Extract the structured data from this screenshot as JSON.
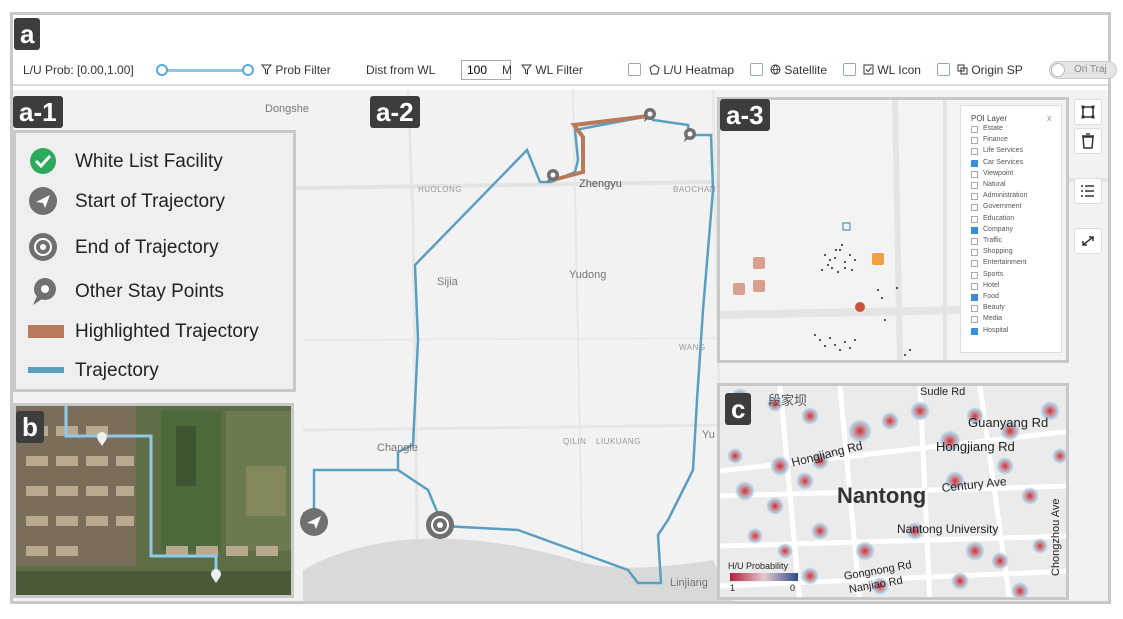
{
  "panels": {
    "a": "a",
    "a1": "a-1",
    "a2": "a-2",
    "a3": "a-3",
    "b": "b",
    "c": "c"
  },
  "toolbar": {
    "lu_prob_label": "L/U Prob: [0.00,1.00]",
    "lu_prob_range": [
      0.0,
      1.0
    ],
    "prob_filter_label": "Prob Filter",
    "dist_label": "Dist from WL",
    "dist_value": "100",
    "dist_unit": "M",
    "wl_filter_label": "WL Filter",
    "lu_heatmap_label": "L/U Heatmap",
    "satellite_label": "Satellite",
    "wl_icon_label": "WL Icon",
    "origin_sp_label": "Origin SP",
    "ori_traj_label": "Ori Traj"
  },
  "legend": {
    "items": [
      {
        "label": "White List Facility",
        "icon": "check-circle-icon",
        "color": "#2eaa5c"
      },
      {
        "label": "Start of Trajectory",
        "icon": "paper-plane-icon",
        "color": "#707070"
      },
      {
        "label": "End of Trajectory",
        "icon": "target-icon",
        "color": "#707070"
      },
      {
        "label": "Other Stay Points",
        "icon": "map-pin-icon",
        "color": "#707070"
      },
      {
        "label": "Highlighted Trajectory",
        "icon": "brown-bar-icon",
        "color": "#b87a5a"
      },
      {
        "label": "Trajectory",
        "icon": "blue-line-icon",
        "color": "#5b9fc0"
      }
    ]
  },
  "map": {
    "labels": {
      "dongshe": "Dongshe",
      "huolong": "HUOLONG",
      "zhengyu": "Zhengyu",
      "baochang": "BAOCHAN",
      "sijia": "Sijia",
      "yudong": "Yudong",
      "changle": "Changle",
      "qilin": "QILIN",
      "liukuang": "LIUKUANG",
      "yu": "Yu",
      "linjiang": "Linjiang",
      "wang": "WANG"
    },
    "colors": {
      "trajectory": "#5b9fc0",
      "highlight": "#b87a5a"
    }
  },
  "poi": {
    "title": "POI Layer",
    "close": "x",
    "layers": [
      {
        "name": "Estate",
        "checked": false
      },
      {
        "name": "Finance",
        "checked": false
      },
      {
        "name": "Life Services",
        "checked": false
      },
      {
        "name": "Car Services",
        "checked": true
      },
      {
        "name": "Viewpoint",
        "checked": false
      },
      {
        "name": "Natural",
        "checked": false
      },
      {
        "name": "Administration",
        "checked": false
      },
      {
        "name": "Government",
        "checked": false
      },
      {
        "name": "Education",
        "checked": false
      },
      {
        "name": "Company",
        "checked": true
      },
      {
        "name": "Traffic",
        "checked": false
      },
      {
        "name": "Shopping",
        "checked": false
      },
      {
        "name": "Entertainment",
        "checked": false
      },
      {
        "name": "Sports",
        "checked": false
      },
      {
        "name": "Hotel",
        "checked": false
      },
      {
        "name": "Food",
        "checked": true
      },
      {
        "name": "Beauty",
        "checked": false
      },
      {
        "name": "Media",
        "checked": false
      },
      {
        "name": "Hospital",
        "checked": true
      }
    ]
  },
  "heatmap": {
    "labels": {
      "duanjiaba": "段家坝",
      "guanyang": "Guanyang Rd",
      "hongjiang": "Hongjiang Rd",
      "hongjiang2": "Hongjiang Rd",
      "nantong": "Nantong",
      "century": "Century Ave",
      "university": "Nantong University",
      "chongzhou": "Chongzhou Ave",
      "gongnong": "Gongnong Rd",
      "nanjiao": "Nanjiao Rd",
      "sudle": "Sudle Rd"
    },
    "legend_title": "H/U Probability",
    "legend_min": "1",
    "legend_max": "0"
  }
}
